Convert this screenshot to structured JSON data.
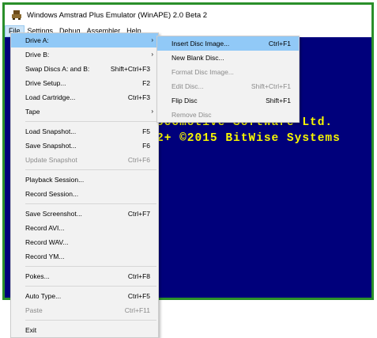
{
  "window": {
    "title": "Windows Amstrad Plus Emulator (WinAPE) 2.0 Beta 2"
  },
  "menubar": [
    "File",
    "Settings",
    "Debug",
    "Assembler",
    "Help"
  ],
  "screen": {
    "line1": "ocomotive Software Ltd.",
    "line2": "2+ ©2015 BitWise Systems"
  },
  "file_menu": {
    "items": [
      {
        "label": "Drive A:",
        "shortcut": "",
        "submenu": true,
        "selected": true
      },
      {
        "label": "Drive B:",
        "shortcut": "",
        "submenu": true
      },
      {
        "label": "Swap Discs A: and B:",
        "shortcut": "Shift+Ctrl+F3"
      },
      {
        "label": "Drive Setup...",
        "shortcut": "F2"
      },
      {
        "label": "Load Cartridge...",
        "shortcut": "Ctrl+F3"
      },
      {
        "label": "Tape",
        "shortcut": "",
        "submenu": true
      },
      {
        "sep": true
      },
      {
        "label": "Load Snapshot...",
        "shortcut": "F5"
      },
      {
        "label": "Save Snapshot...",
        "shortcut": "F6"
      },
      {
        "label": "Update Snapshot",
        "shortcut": "Ctrl+F6",
        "disabled": true
      },
      {
        "sep": true
      },
      {
        "label": "Playback Session...",
        "shortcut": ""
      },
      {
        "label": "Record Session...",
        "shortcut": ""
      },
      {
        "sep": true
      },
      {
        "label": "Save Screenshot...",
        "shortcut": "Ctrl+F7"
      },
      {
        "label": "Record AVI...",
        "shortcut": ""
      },
      {
        "label": "Record WAV...",
        "shortcut": ""
      },
      {
        "label": "Record YM...",
        "shortcut": ""
      },
      {
        "sep": true
      },
      {
        "label": "Pokes...",
        "shortcut": "Ctrl+F8"
      },
      {
        "sep": true
      },
      {
        "label": "Auto Type...",
        "shortcut": "Ctrl+F5"
      },
      {
        "label": "Paste",
        "shortcut": "Ctrl+F11",
        "disabled": true
      },
      {
        "sep": true
      },
      {
        "label": "Exit",
        "shortcut": ""
      }
    ]
  },
  "drive_menu": {
    "items": [
      {
        "label": "Insert Disc Image...",
        "shortcut": "Ctrl+F1",
        "selected": true
      },
      {
        "label": "New Blank Disc...",
        "shortcut": ""
      },
      {
        "label": "Format Disc Image...",
        "shortcut": "",
        "disabled": true
      },
      {
        "label": "Edit Disc...",
        "shortcut": "Shift+Ctrl+F1",
        "disabled": true
      },
      {
        "label": "Flip Disc",
        "shortcut": "Shift+F1"
      },
      {
        "label": "Remove Disc",
        "shortcut": "",
        "disabled": true
      }
    ]
  },
  "colors": {
    "screen_bg": "#00007b",
    "screen_text": "#f7f700",
    "window_border": "#2a8f2a",
    "menu_highlight": "#91c9f7"
  },
  "icons": {
    "app": "amstrad-cpc-icon"
  }
}
